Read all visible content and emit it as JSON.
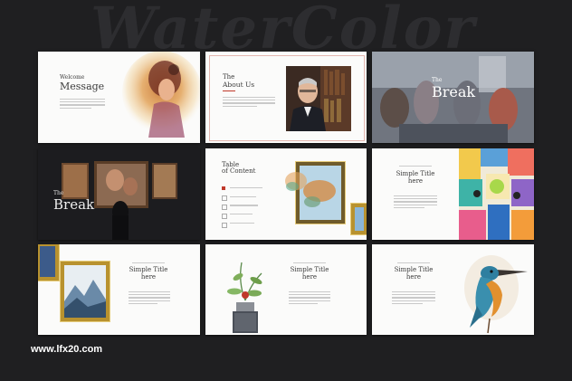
{
  "background_title": "WaterColor",
  "watermark": "www.lfx20.com",
  "slide1": {
    "title_small": "Welcome",
    "title_large": "Message"
  },
  "slide2": {
    "title_small": "The",
    "title_large": "About Us"
  },
  "slide3": {
    "title_small": "The",
    "title_large": "Break"
  },
  "slide4": {
    "title_small": "The",
    "title_large": "Break"
  },
  "slide5": {
    "title_small": "Table",
    "title_large": "of Content"
  },
  "slide6": {
    "title_line1": "Simple Title",
    "title_line2": "here"
  },
  "slide7": {
    "title_line1": "Simple Title",
    "title_line2": "here"
  },
  "slide8": {
    "title_line1": "Simple Title",
    "title_line2": "here"
  },
  "slide9": {
    "title_line1": "Simple Title",
    "title_line2": "here"
  },
  "colors": {
    "background": "#1f1f21",
    "slide": "#fbfbfa",
    "accent_red": "#c0392b",
    "gold": "#b8922f"
  }
}
